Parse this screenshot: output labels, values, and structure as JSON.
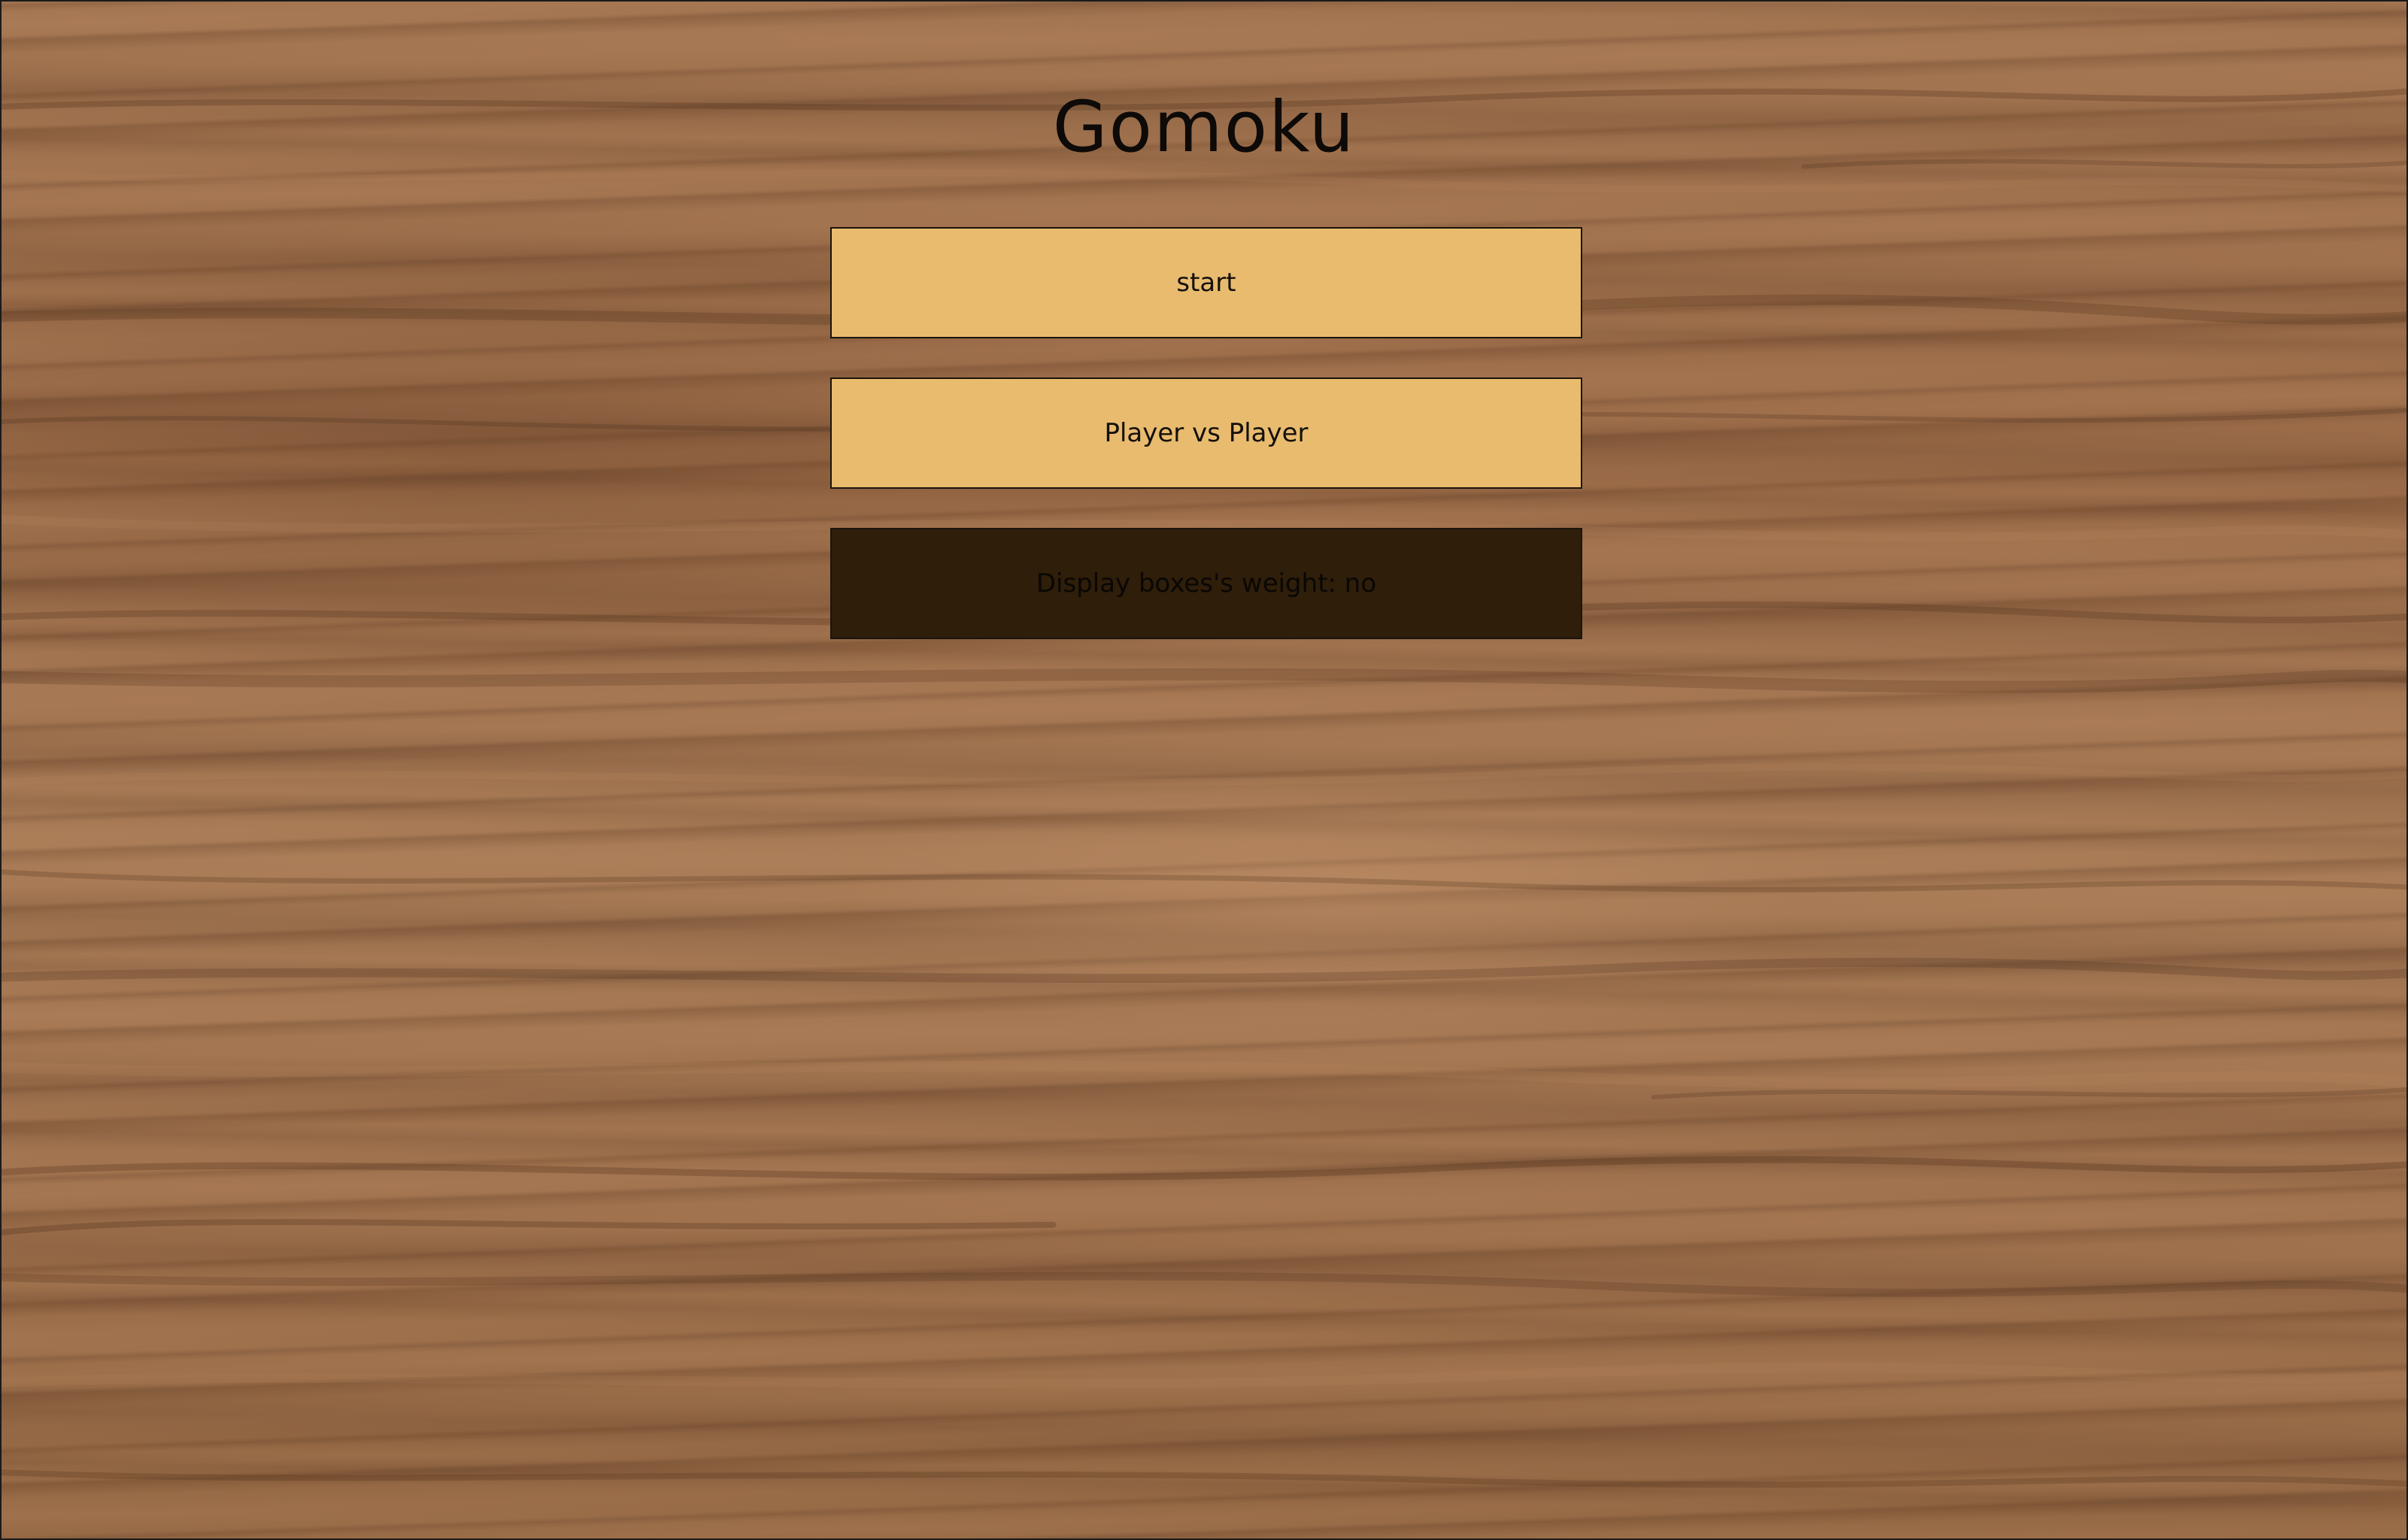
{
  "game": {
    "title": "Gomoku"
  },
  "menu": {
    "start_label": "start",
    "mode_label": "Player vs Player",
    "weight_toggle_label": "Display boxes's weight: no"
  },
  "colors": {
    "button_light": "#e8bb6e",
    "button_dark": "#2e1e0a",
    "background_wood": "#a0714d"
  }
}
